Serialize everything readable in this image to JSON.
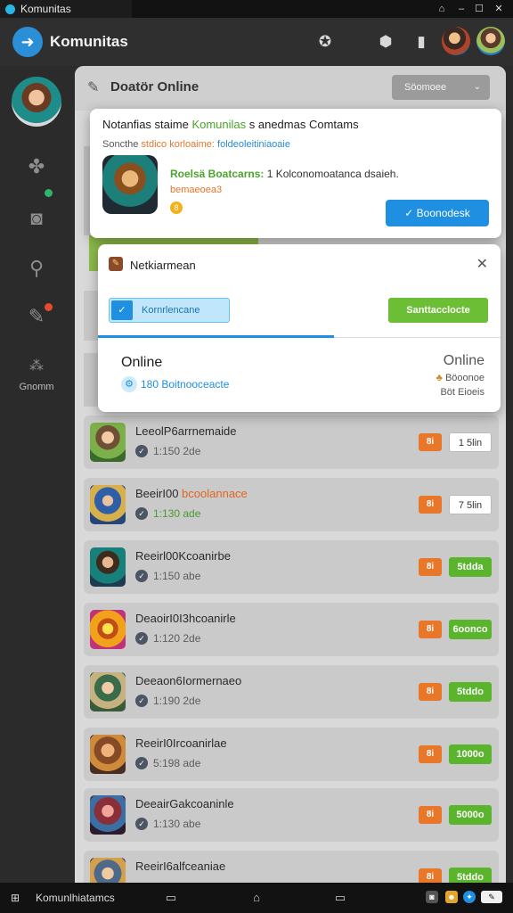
{
  "window": {
    "title": "Komunitas",
    "controls": [
      "⌂",
      "–",
      "☐",
      "✕"
    ]
  },
  "header": {
    "brand": "Komunitas",
    "icons": [
      "star-icon",
      "help-icon",
      "info-icon"
    ]
  },
  "sidebar": {
    "bottom_label": "Gnomm"
  },
  "main": {
    "title": "Doatör Online",
    "dropdown_value": "Söomoee",
    "dropdown_caret": "⌄"
  },
  "popup_top": {
    "heading_prefix": "Notanfias staime ",
    "heading_highlight": "Komunilas",
    "heading_suffix": " s anedmas Comtams",
    "sub_prefix": "Soncthe",
    "sub_orange": " stdico korloaime: ",
    "sub_blue": "foldeoleitiniaoaie",
    "desc_highlight": "Roelsä Boatcarns:",
    "desc_rest": " 1 Kolconomoatanca dsaieh.",
    "desc2": "bemaeoea3",
    "coin": "8",
    "confirm_label": "Boonodesk",
    "confirm_icon": "✓"
  },
  "popup_dialog": {
    "title": "Netkiarmean",
    "close": "✕",
    "tab_active_label": "Kornrlencane",
    "tab_active_icon": "✓",
    "tab_secondary_label": "Santtacclocte",
    "online_left": "Online",
    "stat_icon": "⚙",
    "stat": "180 Boitnooceacte",
    "online_right": "Online",
    "meta1_icon": "♣",
    "meta1": " Böoonoe",
    "meta2": "Böt Eioeis"
  },
  "rows": [
    {
      "name": "LeeolP6arrnemaide",
      "name_hl": "",
      "time": "1:150 2de",
      "tag": "8i",
      "action": "1 5lin"
    },
    {
      "name": "BeeirI00 ",
      "name_hl": "bcoolannace",
      "time": "1:130 ade",
      "tag": "8i",
      "action": "7 5lin"
    },
    {
      "name": "Reeirl00Kcoanirbe",
      "name_hl": "",
      "time": "1:150 abe",
      "tag": "8i",
      "action": "5tdda"
    },
    {
      "name": "DeaoirI0I3hcoanirle",
      "name_hl": "",
      "time": "1:120 2de",
      "tag": "8i",
      "action": "6oonco"
    },
    {
      "name": "Deeaon6Iormernaeo",
      "name_hl": "",
      "time": "1:190 2de",
      "tag": "8i",
      "action": "5tddo"
    },
    {
      "name": "ReeirI0Ircoanirlae",
      "name_hl": "",
      "time": "5:198 ade",
      "tag": "8i",
      "action": "1000o"
    },
    {
      "name": "DeeairGakcoaninle",
      "name_hl": "",
      "time": "1:130 abe",
      "tag": "8i",
      "action": "5000o"
    },
    {
      "name": "ReeirI6alfceaniae",
      "name_hl": "",
      "time": "",
      "tag": "8i",
      "action": "5tddo"
    }
  ],
  "taskbar": {
    "title": "Komunlhiatamcs"
  },
  "colors": {
    "accent_blue": "#1e8fe1",
    "accent_green": "#5ab52d",
    "accent_orange": "#e8772a"
  }
}
